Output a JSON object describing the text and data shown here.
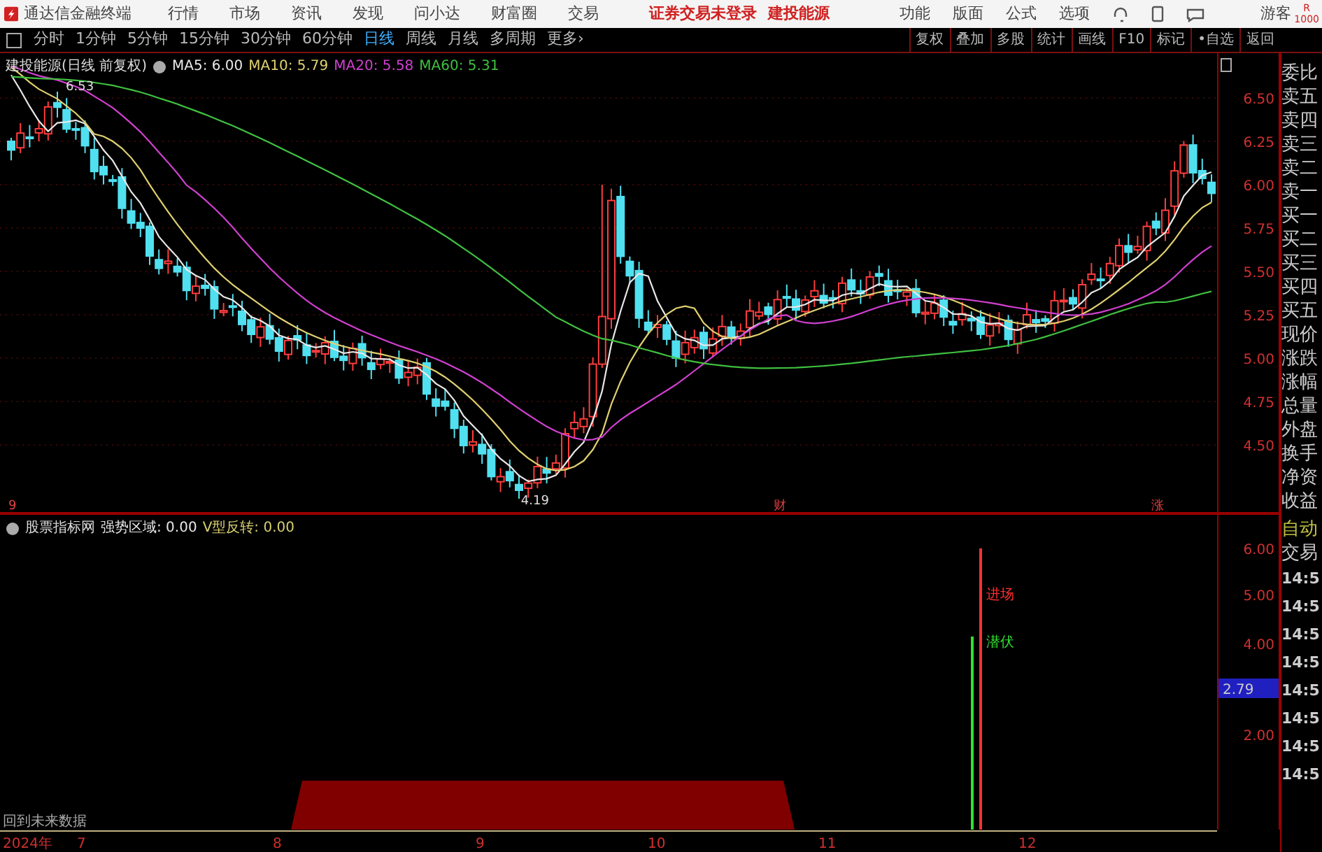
{
  "title_bar": {
    "app_name": "通达信金融终端",
    "menus": [
      "行情",
      "市场",
      "资讯",
      "发现",
      "问小达",
      "财富圈",
      "交易"
    ],
    "notices": [
      "证券交易未登录",
      "建投能源"
    ],
    "tools": [
      "功能",
      "版面",
      "公式",
      "选项"
    ],
    "user": "游客",
    "corner": [
      "R",
      "1000"
    ]
  },
  "period_tabs": [
    {
      "label": "分时",
      "selected": false
    },
    {
      "label": "1分钟",
      "selected": false
    },
    {
      "label": "5分钟",
      "selected": false
    },
    {
      "label": "15分钟",
      "selected": false
    },
    {
      "label": "30分钟",
      "selected": false
    },
    {
      "label": "60分钟",
      "selected": false
    },
    {
      "label": "日线",
      "selected": true
    },
    {
      "label": "周线",
      "selected": false
    },
    {
      "label": "月线",
      "selected": false
    },
    {
      "label": "多周期",
      "selected": false
    },
    {
      "label": "更多›",
      "selected": false
    }
  ],
  "chart_tools": [
    "复权",
    "叠加",
    "多股",
    "统计",
    "画线",
    "F10",
    "标记",
    "•自选",
    "返回"
  ],
  "price_chart": {
    "security": "建投能源(日线 前复权)",
    "ma": [
      {
        "label": "MA5: 6.00",
        "color": "#e8e8e8"
      },
      {
        "label": "MA10: 5.79",
        "color": "#e0d070"
      },
      {
        "label": "MA20: 5.58",
        "color": "#d040d0"
      },
      {
        "label": "MA60: 5.31",
        "color": "#40c040"
      }
    ],
    "high_label": "6.53",
    "low_label": "4.19",
    "markers": [
      "9",
      "财",
      "涨"
    ],
    "yticks": [
      "6.50",
      "6.25",
      "6.00",
      "5.75",
      "5.50",
      "5.25",
      "5.00",
      "4.75",
      "4.50"
    ]
  },
  "indicator_panel": {
    "name": "股票指标网",
    "values": [
      {
        "label": "强势区域: 0.00",
        "color": "#e8e8e8"
      },
      {
        "label": "V型反转: 0.00",
        "color": "#d8d070"
      }
    ],
    "signals": [
      {
        "label": "进场",
        "color": "#ff3030"
      },
      {
        "label": "潜伏",
        "color": "#30e030"
      }
    ],
    "footnote": "回到未来数据",
    "yticks": [
      "6.00",
      "5.00",
      "4.00",
      "2.00"
    ],
    "current": "2.79"
  },
  "date_axis": {
    "year": "2024年",
    "months": [
      "7",
      "8",
      "9",
      "10",
      "11",
      "12"
    ]
  },
  "quote_panel": {
    "labels": [
      "委比",
      "卖五",
      "卖四",
      "卖三",
      "卖二",
      "卖一",
      "买一",
      "买二",
      "买三",
      "买四",
      "买五",
      "现价",
      "涨跌",
      "涨幅",
      "总量",
      "外盘",
      "换手",
      "净资",
      "收益"
    ],
    "auto": "自动",
    "trade": "交易",
    "times": [
      "14:5",
      "14:5",
      "14:5",
      "14:5",
      "14:5",
      "14:5",
      "14:5",
      "14:5"
    ]
  }
}
